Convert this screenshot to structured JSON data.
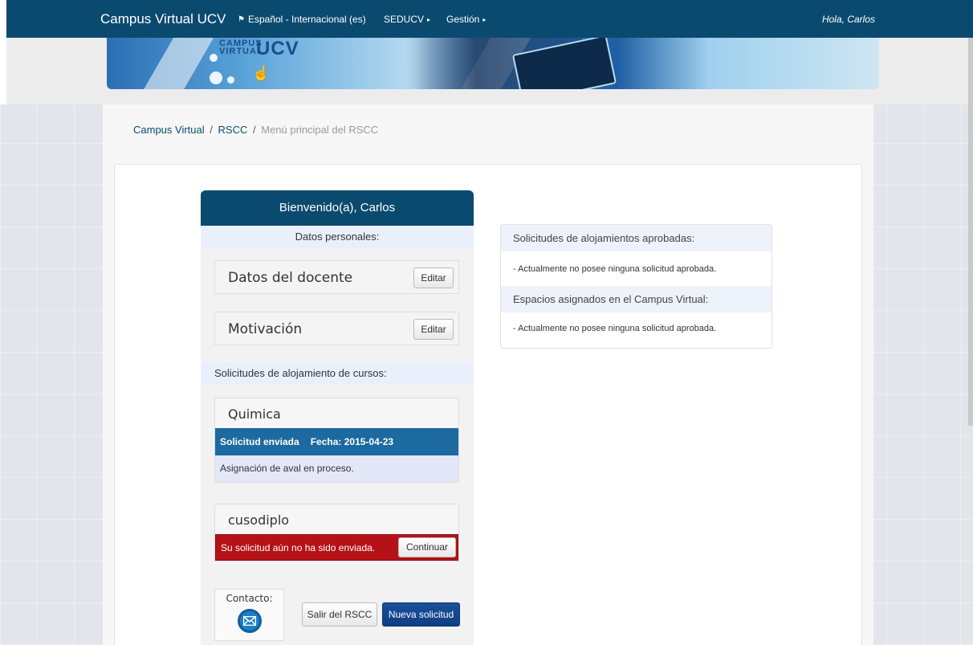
{
  "navbar": {
    "brand": "Campus Virtual UCV",
    "language": "Español - Internacional (es)",
    "menu_seducv": "SEDUCV",
    "menu_gestion": "Gestión",
    "greeting": "Hola, Carlos"
  },
  "banner": {
    "logo_line1": "CAMPUS",
    "logo_line2": "VIRTUAL",
    "logo_ucv": "UCV"
  },
  "breadcrumb": {
    "item1": "Campus Virtual",
    "item2": "RSCC",
    "item3": "Menú principal del RSCC",
    "separator": "/"
  },
  "card": {
    "header": "Bienvenido(a), Carlos",
    "personal_label": "Datos personales:",
    "datos_docente": "Datos del docente",
    "motivacion": "Motivación",
    "edit_label": "Editar",
    "solicitudes_label": "Solicitudes de alojamiento de cursos:",
    "courses": [
      {
        "name": "Quimica",
        "status": "Solicitud enviada",
        "date": "Fecha: 2015-04-23",
        "note": "Asignación de aval en proceso."
      },
      {
        "name": "cusodiplo",
        "status": "Su solicitud aún no ha sido enviada.",
        "action": "Continuar"
      }
    ],
    "contact_label": "Contacto:",
    "salir": "Salir del RSCC",
    "nueva": "Nueva solicitud"
  },
  "right_panel": {
    "approved_header": "Solicitudes de alojamientos aprobadas:",
    "approved_body": "- Actualmente no posee ninguna solicitud aprobada.",
    "spaces_header": "Espacios asignados en el Campus Virtual:",
    "spaces_body": "- Actualmente no posee ninguna solicitud aprobada."
  },
  "colors": {
    "primary": "#0b4a6f",
    "status_blue": "#1c6a9f",
    "status_red": "#b51217",
    "button_blue": "#1a4f9a"
  }
}
